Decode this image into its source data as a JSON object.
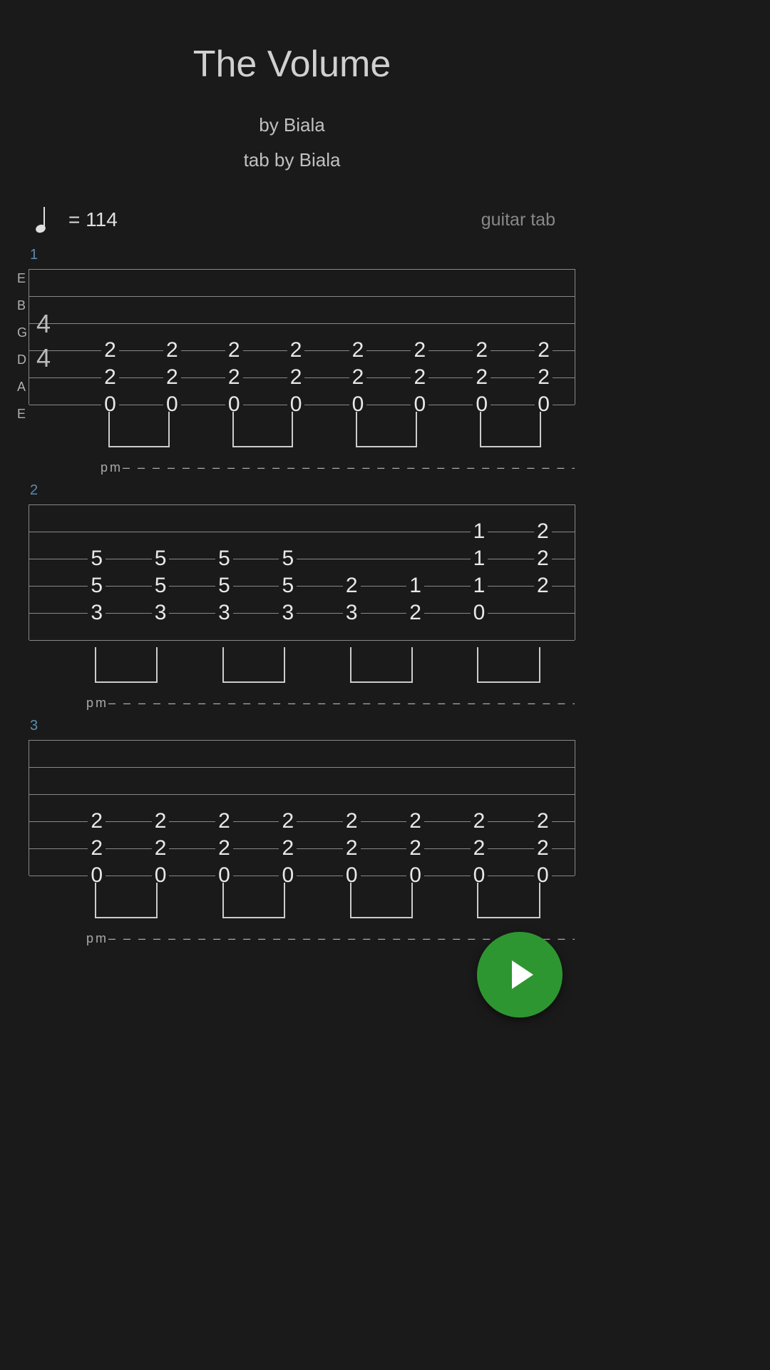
{
  "title": "The Volume",
  "byline": "by Biala",
  "tabby": "tab by Biala",
  "tempo": "= 114",
  "track": "guitar tab",
  "strings": [
    "E",
    "B",
    "G",
    "D",
    "A",
    "E"
  ],
  "timesig_top": "4",
  "timesig_bot": "4",
  "pm_label": "pm",
  "measures": [
    {
      "num": "1",
      "timesig": true,
      "pm_cols": 8,
      "cols": [
        {
          "D": "2",
          "A": "2",
          "E": "0"
        },
        {
          "D": "2",
          "A": "2",
          "E": "0"
        },
        {
          "D": "2",
          "A": "2",
          "E": "0"
        },
        {
          "D": "2",
          "A": "2",
          "E": "0"
        },
        {
          "D": "2",
          "A": "2",
          "E": "0"
        },
        {
          "D": "2",
          "A": "2",
          "E": "0"
        },
        {
          "D": "2",
          "A": "2",
          "E": "0"
        },
        {
          "D": "2",
          "A": "2",
          "E": "0"
        }
      ]
    },
    {
      "num": "2",
      "timesig": false,
      "pm_cols": 6,
      "cols": [
        {
          "G": "5",
          "D": "5",
          "A": "3"
        },
        {
          "G": "5",
          "D": "5",
          "A": "3"
        },
        {
          "G": "5",
          "D": "5",
          "A": "3"
        },
        {
          "G": "5",
          "D": "5",
          "A": "3"
        },
        {
          "D": "2",
          "A": "3"
        },
        {
          "D": "1",
          "A": "2"
        },
        {
          "B": "1",
          "G": "1",
          "D": "1",
          "A": "0"
        },
        {
          "B": "2",
          "G": "2",
          "D": "2"
        }
      ]
    },
    {
      "num": "3",
      "timesig": false,
      "pm_cols": 8,
      "cols": [
        {
          "D": "2",
          "A": "2",
          "E": "0"
        },
        {
          "D": "2",
          "A": "2",
          "E": "0"
        },
        {
          "D": "2",
          "A": "2",
          "E": "0"
        },
        {
          "D": "2",
          "A": "2",
          "E": "0"
        },
        {
          "D": "2",
          "A": "2",
          "E": "0"
        },
        {
          "D": "2",
          "A": "2",
          "E": "0"
        },
        {
          "D": "2",
          "A": "2",
          "E": "0"
        },
        {
          "D": "2",
          "A": "2",
          "E": "0"
        }
      ]
    }
  ]
}
